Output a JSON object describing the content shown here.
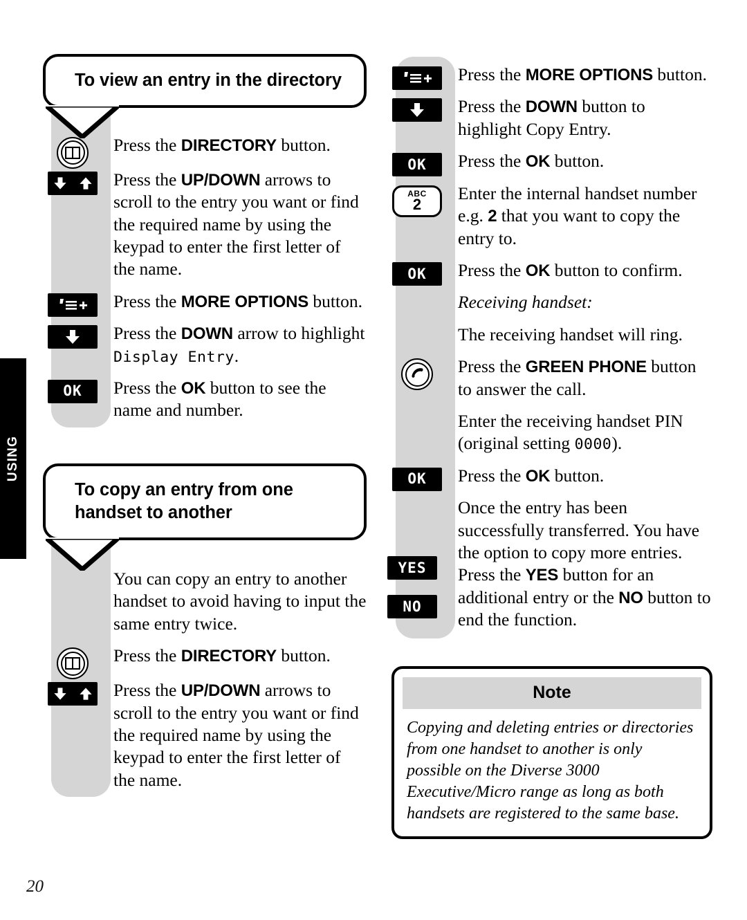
{
  "page": {
    "number": "20",
    "chapter_tab": "USING"
  },
  "icons": {
    "directory": "book-icon",
    "updown": "up-down-arrows-icon",
    "down": "down-arrow-icon",
    "more_options": "more-options-icon",
    "ok": "ok-button-icon",
    "keypad2": "keypad-2-icon",
    "green_phone": "green-phone-icon",
    "yes": "yes-button-icon",
    "no": "no-button-icon"
  },
  "labels": {
    "ok": "OK",
    "yes": "YES",
    "no": "NO",
    "keypad_letters": "ABC",
    "keypad_digit": "2"
  },
  "left_column": {
    "section1": {
      "heading": "To view an entry in the directory",
      "steps": [
        {
          "icon": "directory",
          "html": "Press the <b>DIRECTORY</b> button."
        },
        {
          "icon": "updown",
          "html": "Press the <b>UP/DOWN</b> arrows to scroll to the entry you want or find the required name by using the keypad to enter the first letter of the name."
        },
        {
          "icon": "more_options",
          "html": "Press the <b>MORE OPTIONS</b> button."
        },
        {
          "icon": "down",
          "html": "Press the <b>DOWN</b> arrow to highlight <span class=\"lcd\">Display Entry</span>."
        },
        {
          "icon": "ok",
          "html": "Press the <b>OK</b> button to see the name and number."
        }
      ]
    },
    "section2": {
      "heading": "To copy an entry from one handset to another",
      "steps": [
        {
          "icon": "none",
          "html": "You can copy an entry to another handset to avoid having to input the same entry twice."
        },
        {
          "icon": "directory",
          "html": "Press the <b>DIRECTORY</b> button."
        },
        {
          "icon": "updown",
          "html": "Press the <b>UP/DOWN</b> arrows to scroll to the entry you want or find the required name by using the keypad to enter the first letter of the name."
        }
      ]
    }
  },
  "right_column": {
    "steps": [
      {
        "icon": "more_options",
        "html": "Press the <b>MORE OPTIONS</b> button."
      },
      {
        "icon": "down",
        "html": "Press the <b>DOWN</b> button to highlight Copy Entry."
      },
      {
        "icon": "ok",
        "html": "Press the <b>OK</b> button."
      },
      {
        "icon": "keypad2",
        "html": "Enter the internal handset number e.g. <b>2</b> that you want to copy the entry to."
      },
      {
        "icon": "ok",
        "html": "Press the <b>OK</b> button to confirm."
      },
      {
        "icon": "none",
        "html": "Receiving handset:",
        "style": "italic-head"
      },
      {
        "icon": "none",
        "html": "The receiving handset will ring."
      },
      {
        "icon": "green_phone",
        "html": "Press the <b>GREEN PHONE</b> button to answer the call."
      },
      {
        "icon": "none",
        "html": "Enter the receiving handset PIN (original setting <span class=\"lcd\">0000</span>)."
      },
      {
        "icon": "ok",
        "html": "Press the <b>OK</b> button."
      },
      {
        "icon": "yesno",
        "html": "Once the entry has been successfully transferred. You have the option to copy more entries. Press the <b>YES</b> button for an additional entry or the <b>NO</b> button to end the function."
      }
    ],
    "note": {
      "title": "Note",
      "body": "Copying and deleting entries or directories from one handset to another is only possible on the Diverse 3000 Executive/Micro range as long as both handsets are registered to the same base."
    }
  },
  "colors": {
    "rail_gray": "#d5d5d5",
    "ink": "#000000",
    "paper": "#ffffff"
  }
}
